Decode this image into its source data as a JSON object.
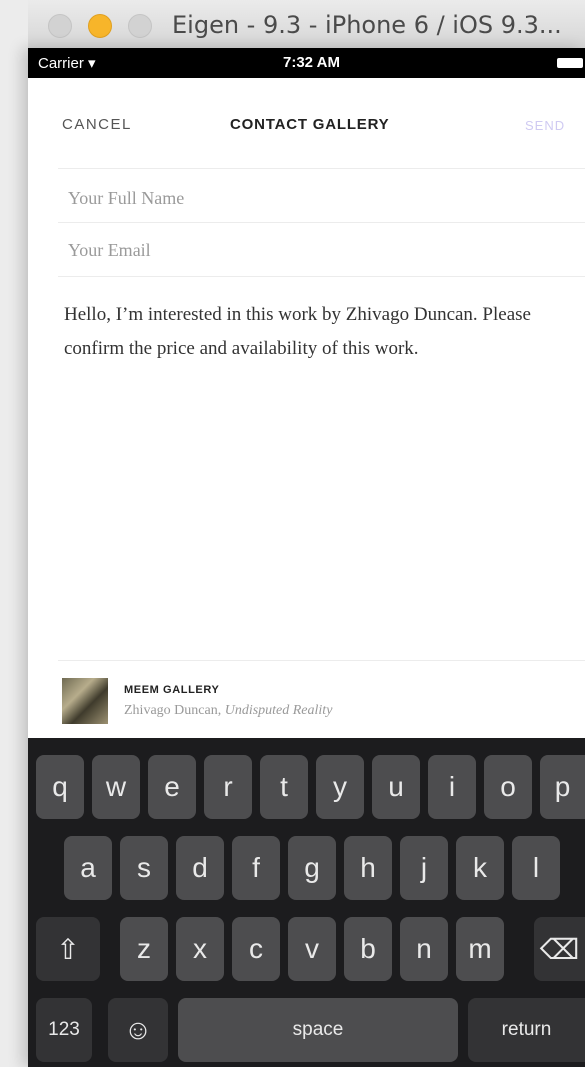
{
  "window": {
    "title": "Eigen - 9.3 - iPhone 6 / iOS 9.3..."
  },
  "status_bar": {
    "carrier": "Carrier",
    "wifi_icon": "wifi-icon",
    "time": "7:32 AM"
  },
  "nav": {
    "cancel": "CANCEL",
    "title": "CONTACT GALLERY",
    "send": "SEND"
  },
  "form": {
    "name_placeholder": "Your Full Name",
    "email_placeholder": "Your Email",
    "message": "Hello, I’m interested in this work by Zhivago Duncan. Please confirm the price and availability of this work."
  },
  "artwork": {
    "gallery": "MEEM GALLERY",
    "artist": "Zhivago Duncan, ",
    "title": "Undisputed Reality"
  },
  "keyboard": {
    "row1": [
      "q",
      "w",
      "e",
      "r",
      "t",
      "y",
      "u",
      "i",
      "o",
      "p"
    ],
    "row2": [
      "a",
      "s",
      "d",
      "f",
      "g",
      "h",
      "j",
      "k",
      "l"
    ],
    "row3": [
      "z",
      "x",
      "c",
      "v",
      "b",
      "n",
      "m"
    ],
    "shift": "⇧",
    "backspace": "⌫",
    "numbers": "123",
    "emoji": "☺",
    "space": "space",
    "return": "return"
  }
}
